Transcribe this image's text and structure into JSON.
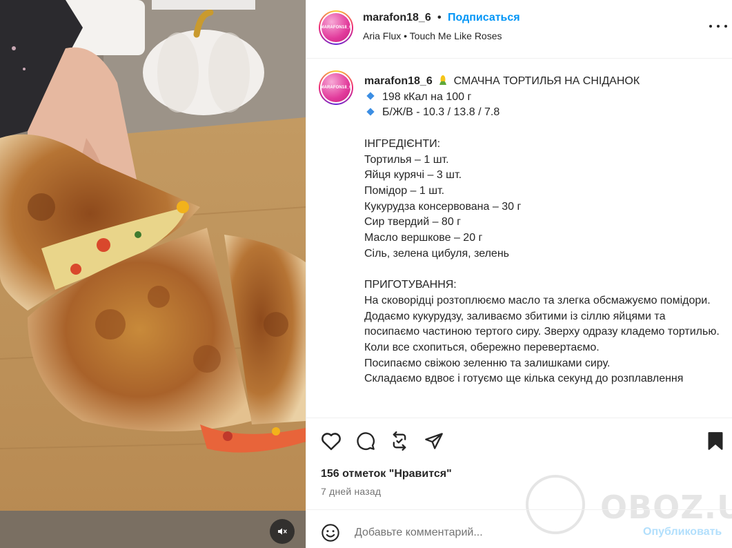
{
  "post": {
    "username": "marafon18_6",
    "avatar_text": "MARAFON18_6",
    "separator": "•",
    "follow_label": "Подписаться",
    "audio": "Aria Flux • Touch Me Like Roses",
    "more_icon": "more-horizontal-icon"
  },
  "caption": {
    "username": "marafon18_6",
    "title": "СМАЧНА ТОРТИЛЬЯ НА СНІДАНОК",
    "nutrition": [
      "198 кКал на 100 г",
      "Б/Ж/В - 10.3 / 13.8 / 7.8"
    ],
    "ingredients_heading": "ІНГРЕДІЄНТИ:",
    "ingredients": [
      "Тортилья – 1 шт.",
      "Яйця курячі – 3 шт.",
      "Помідор – 1 шт.",
      "Кукурудза консервована – 30 г",
      "Сир твердий – 80 г",
      "Масло вершкове – 20 г",
      "Сіль, зелена цибуля, зелень"
    ],
    "preparation_heading": "ПРИГОТУВАННЯ:",
    "steps": [
      "На сковорідці розтоплюємо масло та злегка обсмажуємо помідори.",
      "Додаємо кукурудзу, заливаємо збитими із сіллю яйцями та посипаємо частиною тертого сиру. Зверху одразу кладемо тортилью.",
      "Коли все схопиться, обережно перевертаємо.",
      "Посипаємо свіжою зеленню та залишками сиру.",
      "Складаємо вдвоє і готуємо ще кілька секунд до розплавлення"
    ]
  },
  "actions": {
    "icons": [
      "heart-icon",
      "comment-icon",
      "repost-icon",
      "share-icon",
      "bookmark-icon"
    ]
  },
  "likes": "156 отметок \"Нравится\"",
  "time": "7 дней назад",
  "comment": {
    "placeholder": "Добавьте комментарий...",
    "publish_label": "Опубликовать"
  },
  "watermark": "OBOZ.UA",
  "colors": {
    "link_blue": "#0095f6",
    "publish_disabled": "#b2dffc",
    "diamond_blue": "#3c8ee3"
  }
}
